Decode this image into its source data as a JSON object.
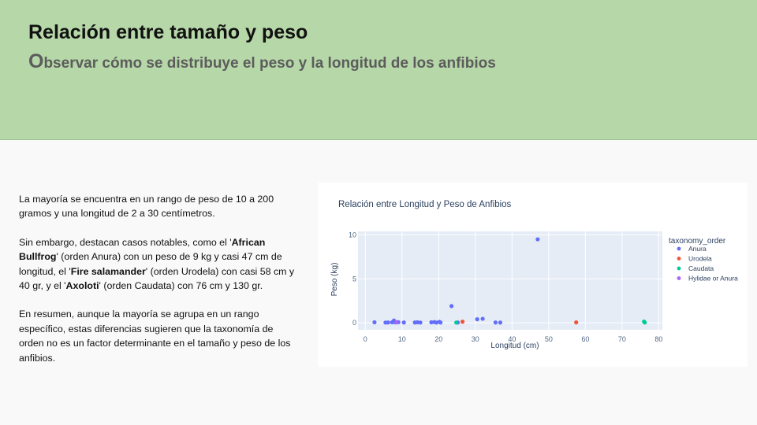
{
  "header": {
    "title": "Relación entre tamaño y peso",
    "subtitle_first": "O",
    "subtitle_rest": "bservar cómo se distribuye el peso y la longitud de los anfibios"
  },
  "body": {
    "p1": "La mayoría se encuentra en un rango de peso de 10 a 200 gramos y una longitud de 2 a 30 centímetros.",
    "p2_a": "Sin embargo, destacan casos notables, como el '",
    "p2_b": "African Bullfrog",
    "p2_c": "' (orden Anura) con un peso de 9 kg y casi 47 cm de longitud, el '",
    "p2_d": "Fire salamander",
    "p2_e": "' (orden Urodela) con casi 58 cm y 40 gr, y el '",
    "p2_f": "Axoloti",
    "p2_g": "' (orden Caudata) con 76 cm y 130 gr.",
    "p3": "En resumen, aunque la mayoría se agrupa en un rango específico, estas diferencias sugieren que la taxonomía de orden no es un factor determinante en el tamaño y peso de los anfibios."
  },
  "colors": {
    "header_bg": "#b6d7a8",
    "plot_bg": "#e5ecf6",
    "anura": "#636efa",
    "urodela": "#ef553b",
    "caudata": "#00cc96",
    "hylidae": "#ab63fa"
  },
  "chart_data": {
    "type": "scatter",
    "title": "Relación entre Longitud y Peso de Anfibios",
    "xlabel": "Longitud (cm)",
    "ylabel": "Peso (kg)",
    "xlim": [
      -2,
      81
    ],
    "ylim": [
      -0.8,
      10.4
    ],
    "xticks": [
      0,
      10,
      20,
      30,
      40,
      50,
      60,
      70,
      80
    ],
    "yticks": [
      0,
      5,
      10
    ],
    "grid": true,
    "legend_title": "taxonomy_order",
    "legend_position": "right",
    "series": [
      {
        "name": "Anura",
        "color": "#636efa",
        "points": [
          [
            2.5,
            0.05
          ],
          [
            5.5,
            0.02
          ],
          [
            6.2,
            0.03
          ],
          [
            7.3,
            0.05
          ],
          [
            7.8,
            0.25
          ],
          [
            8.2,
            0.04
          ],
          [
            9.0,
            0.06
          ],
          [
            10.5,
            0.03
          ],
          [
            13.5,
            0.03
          ],
          [
            14.2,
            0.05
          ],
          [
            15.0,
            0.02
          ],
          [
            18.0,
            0.05
          ],
          [
            18.8,
            0.08
          ],
          [
            19.4,
            0.02
          ],
          [
            20.2,
            0.1
          ],
          [
            20.5,
            0.03
          ],
          [
            23.5,
            1.9
          ],
          [
            25.2,
            0.03
          ],
          [
            30.5,
            0.4
          ],
          [
            32.0,
            0.45
          ],
          [
            35.5,
            0.03
          ],
          [
            36.8,
            0.02
          ],
          [
            47.0,
            9.5
          ]
        ]
      },
      {
        "name": "Urodela",
        "color": "#ef553b",
        "points": [
          [
            26.5,
            0.12
          ],
          [
            57.5,
            0.04
          ]
        ]
      },
      {
        "name": "Caudata",
        "color": "#00cc96",
        "points": [
          [
            24.8,
            0.02
          ],
          [
            76.0,
            0.13
          ],
          [
            76.2,
            0.03
          ]
        ]
      },
      {
        "name": "Hylidae or Anura",
        "color": "#ab63fa",
        "points": [
          [
            8.5,
            0.06
          ]
        ]
      }
    ]
  }
}
